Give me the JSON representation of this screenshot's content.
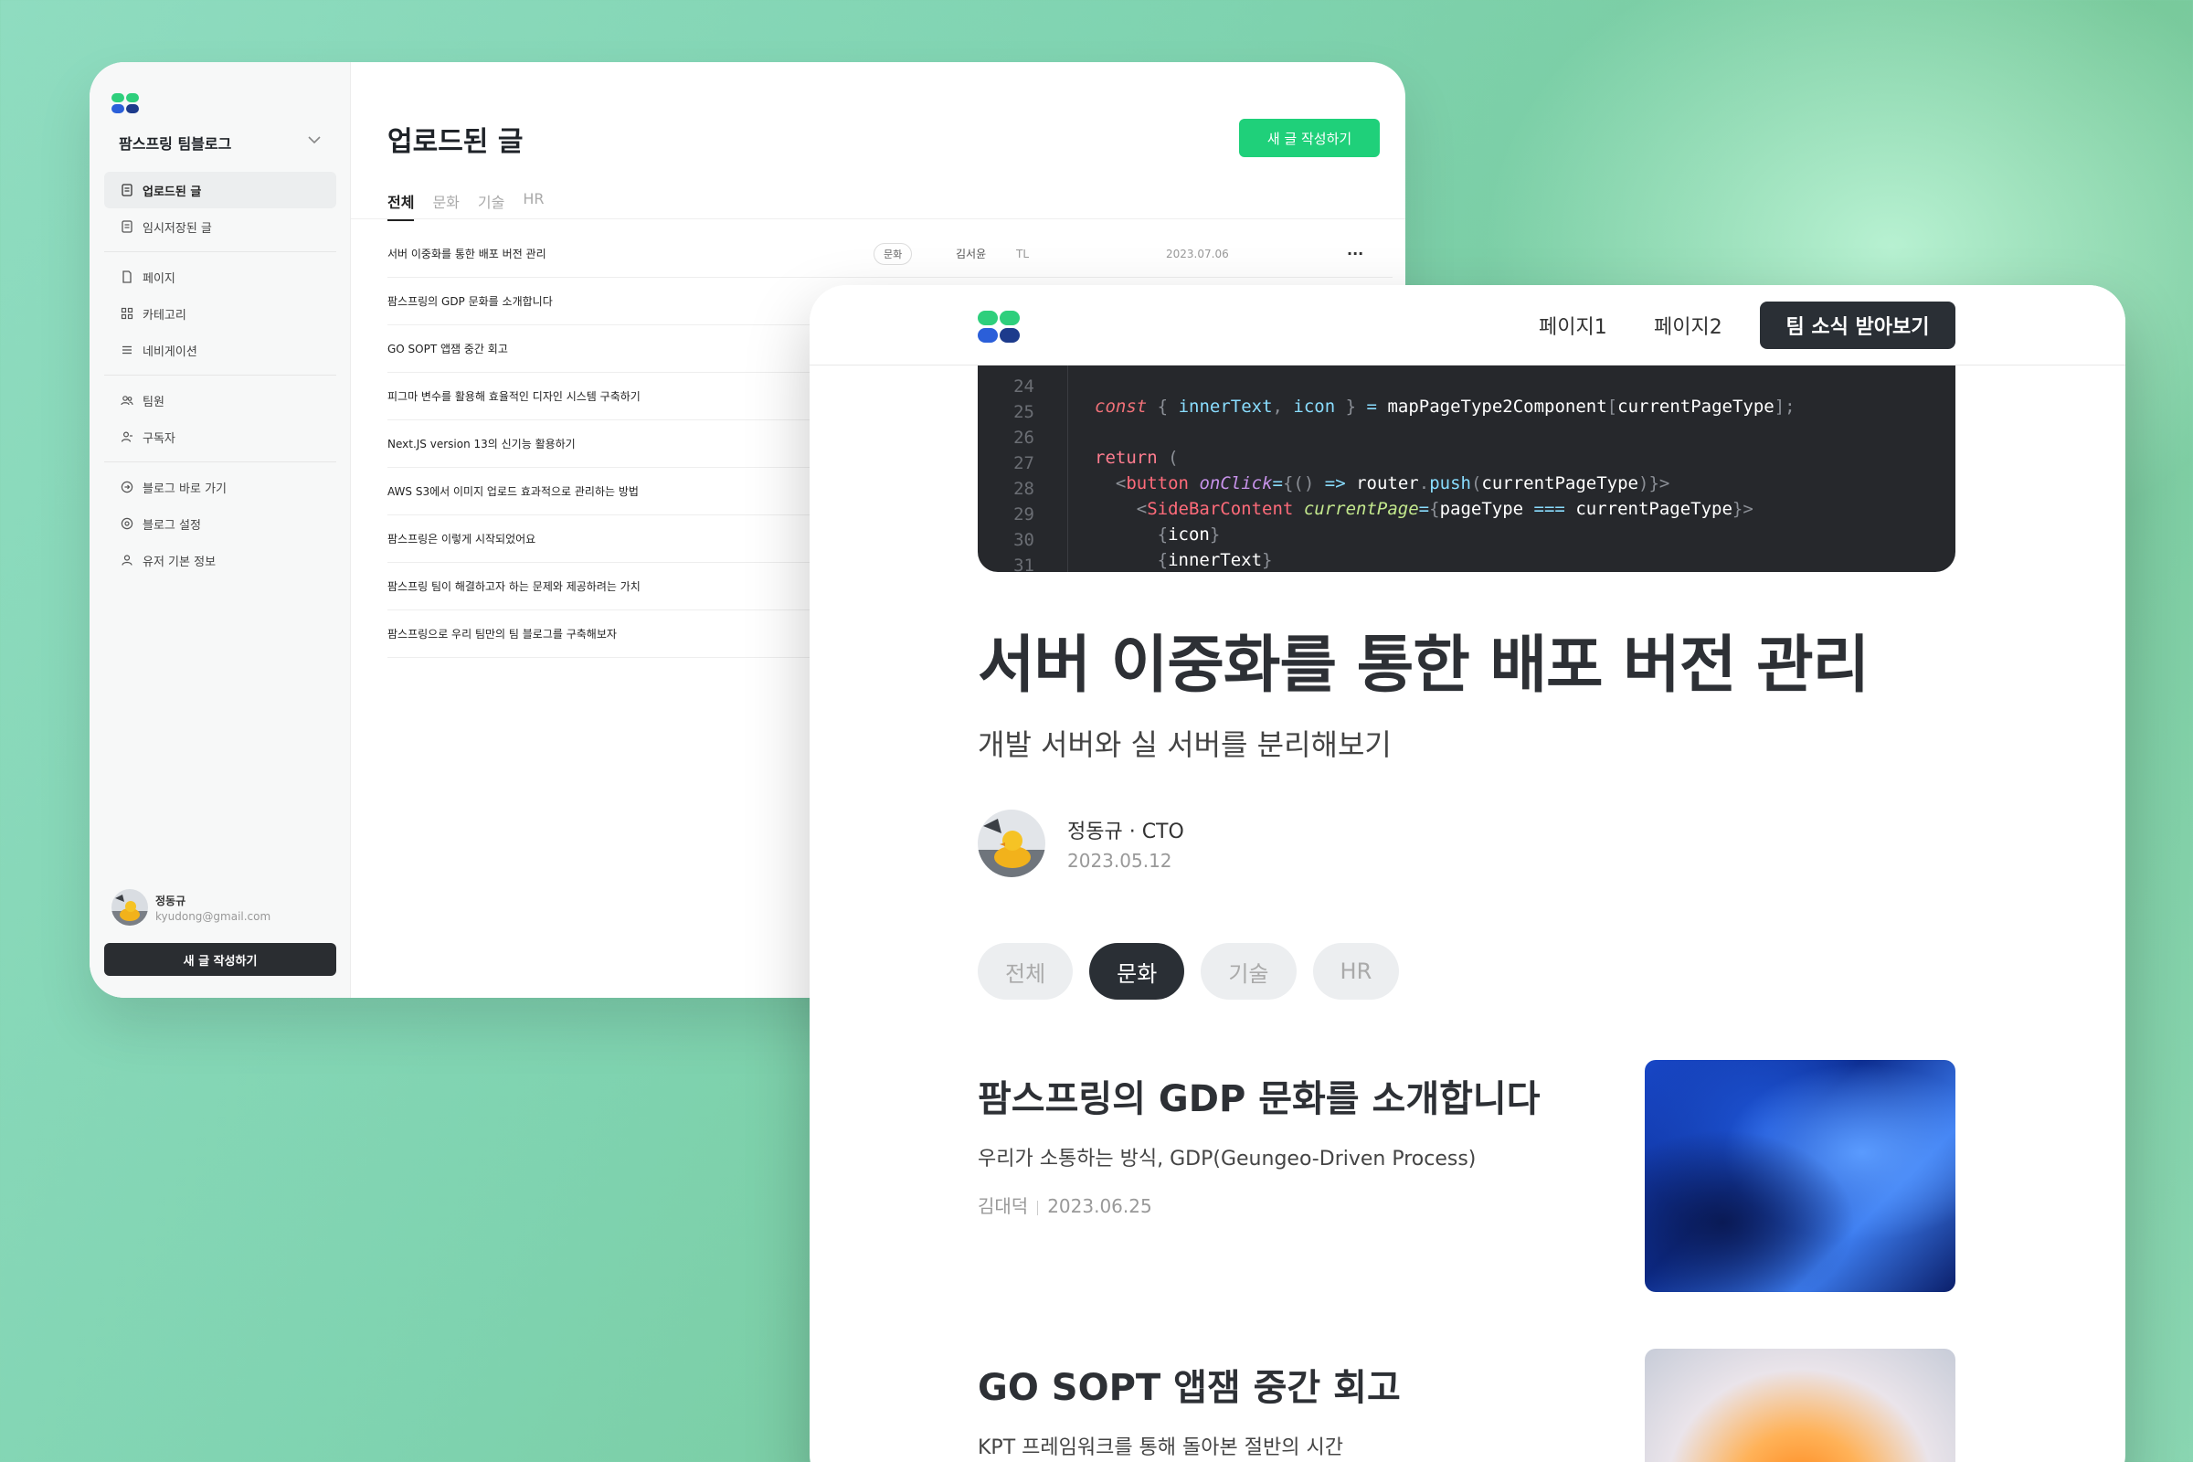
{
  "admin": {
    "blog_name": "팜스프링 팀블로그",
    "page_title": "업로드된 글",
    "new_post_label": "새 글 작성하기",
    "sidebar_items": [
      {
        "label": "업로드된 글",
        "icon": "document-icon",
        "active": true
      },
      {
        "label": "임시저장된 글",
        "icon": "document-icon",
        "active": false
      },
      {
        "label": "페이지",
        "icon": "page-icon",
        "active": false
      },
      {
        "label": "카테고리",
        "icon": "grid-icon",
        "active": false
      },
      {
        "label": "네비게이션",
        "icon": "menu-icon",
        "active": false
      },
      {
        "label": "팀원",
        "icon": "team-icon",
        "active": false
      },
      {
        "label": "구독자",
        "icon": "subscriber-icon",
        "active": false
      },
      {
        "label": "블로그 바로 가기",
        "icon": "arrow-circle-icon",
        "active": false
      },
      {
        "label": "블로그 설정",
        "icon": "settings-icon",
        "active": false
      },
      {
        "label": "유저 기본 정보",
        "icon": "user-icon",
        "active": false
      }
    ],
    "tabs": [
      "전체",
      "문화",
      "기술",
      "HR"
    ],
    "active_tab": "전체",
    "posts": [
      {
        "title": "서버 이중화를 통한 배포 버전 관리",
        "tag": "문화",
        "author": "김서윤",
        "role": "TL",
        "date": "2023.07.06"
      },
      {
        "title": "팜스프링의 GDP 문화를 소개합니다"
      },
      {
        "title": "GO SOPT 앱잼 중간 회고"
      },
      {
        "title": "피그마 변수를 활용해 효율적인 디자인 시스템 구축하기"
      },
      {
        "title": "Next.JS version 13의 신기능 활용하기"
      },
      {
        "title": "AWS S3에서 이미지 업로드 효과적으로 관리하는 방법"
      },
      {
        "title": "팜스프링은 이렇게 시작되었어요"
      },
      {
        "title": "팜스프링 팀이 해결하고자 하는 문제와 제공하려는 가치"
      },
      {
        "title": "팜스프링으로 우리 팀만의 팀 블로그를 구축해보자"
      }
    ],
    "more_glyph": "···",
    "user": {
      "name": "정동규",
      "email": "kyudong@gmail.com"
    },
    "sidebar_new_label": "새 글 작성하기"
  },
  "blog": {
    "nav": [
      "페이지1",
      "페이지2"
    ],
    "subscribe_label": "팀 소식 받아보기",
    "code_lines": [
      {
        "n": "24"
      },
      {
        "n": "25"
      },
      {
        "n": "26"
      },
      {
        "n": "27"
      },
      {
        "n": "28"
      },
      {
        "n": "29"
      },
      {
        "n": "30"
      },
      {
        "n": "31"
      }
    ],
    "article_title": "서버 이중화를 통한 배포 버전 관리",
    "article_subtitle": "개발 서버와 실 서버를 분리해보기",
    "author": "정동규 · CTO",
    "date": "2023.05.12",
    "chips": [
      "전체",
      "문화",
      "기술",
      "HR"
    ],
    "active_chip": "문화",
    "posts": [
      {
        "title": "팜스프링의 GDP 문화를 소개합니다",
        "desc": "우리가 소통하는 방식, GDP(Geungeo-Driven Process)",
        "author": "김대덕",
        "date": "2023.06.25"
      },
      {
        "title": "GO SOPT 앱잼 중간 회고",
        "desc": "KPT 프레임워크를 통해 돌아본 절반의 시간"
      }
    ]
  },
  "colors": {
    "accent": "#1fd07a",
    "dark": "#2a2f35",
    "logo_green": "#2ecf7c",
    "logo_blue": "#2b5fd9",
    "logo_navy": "#1d3b8c"
  }
}
